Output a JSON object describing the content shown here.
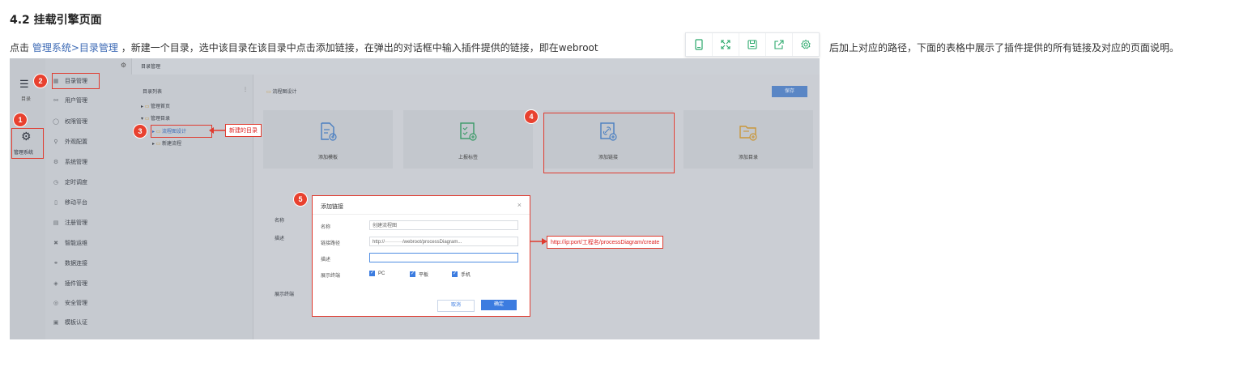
{
  "heading": "4.2 挂载引擎页面",
  "paragraph": {
    "prefix": "点击 ",
    "link": "管理系统>目录管理",
    "middle": " ，新建一个目录，选中该目录在该目录中点击添加链接，在弹出的对话框中输入插件提供的链接，即在webroot",
    "suffix": "后加上对应的路径，下面的表格中展示了插件提供的所有链接及对应的页面说明。"
  },
  "float_toolbar": {
    "icons": [
      "mobile-icon",
      "expand-icon",
      "save-icon",
      "share-icon",
      "settings-icon"
    ]
  },
  "screenshot": {
    "topbar_title": "目录管理",
    "rail": {
      "dir_label": "目录",
      "system_label": "管理系统"
    },
    "menu": [
      "目录管理",
      "用户管理",
      "权限管理",
      "外观配置",
      "系统管理",
      "定时调度",
      "移动平台",
      "注册管理",
      "智能运维",
      "数据连接",
      "插件管理",
      "安全管理",
      "模板认证"
    ],
    "tree": {
      "header": "目录列表",
      "items": [
        "管理首页",
        "管理目录",
        "流程图设计",
        "新建流程"
      ]
    },
    "main": {
      "breadcrumb": "流程图设计",
      "save_button": "保存",
      "cards": [
        "添加模板",
        "上报标签",
        "添加链接",
        "添加目录"
      ],
      "bg_labels": [
        "名称",
        "描述",
        "展示终端"
      ]
    },
    "badges": [
      "1",
      "2",
      "3",
      "4",
      "5"
    ],
    "callout_new_dir": "新建的目录",
    "callout_url": "http://ip:port/工程名/processDiagram/create",
    "dialog": {
      "title": "添加链接",
      "close": "×",
      "name_label": "名称",
      "name_value": "创建流程图",
      "path_label": "链接路径",
      "path_value": "http://···········/webroot/processDiagram...",
      "desc_label": "描述",
      "desc_value": "",
      "terminal_label": "展示终端",
      "terminals": [
        "PC",
        "平板",
        "手机"
      ],
      "cancel": "取消",
      "confirm": "确定"
    }
  },
  "colors": {
    "link": "#3d6ab5",
    "annotation_red": "#e03b2f",
    "primary_blue": "#3c7ce0"
  }
}
